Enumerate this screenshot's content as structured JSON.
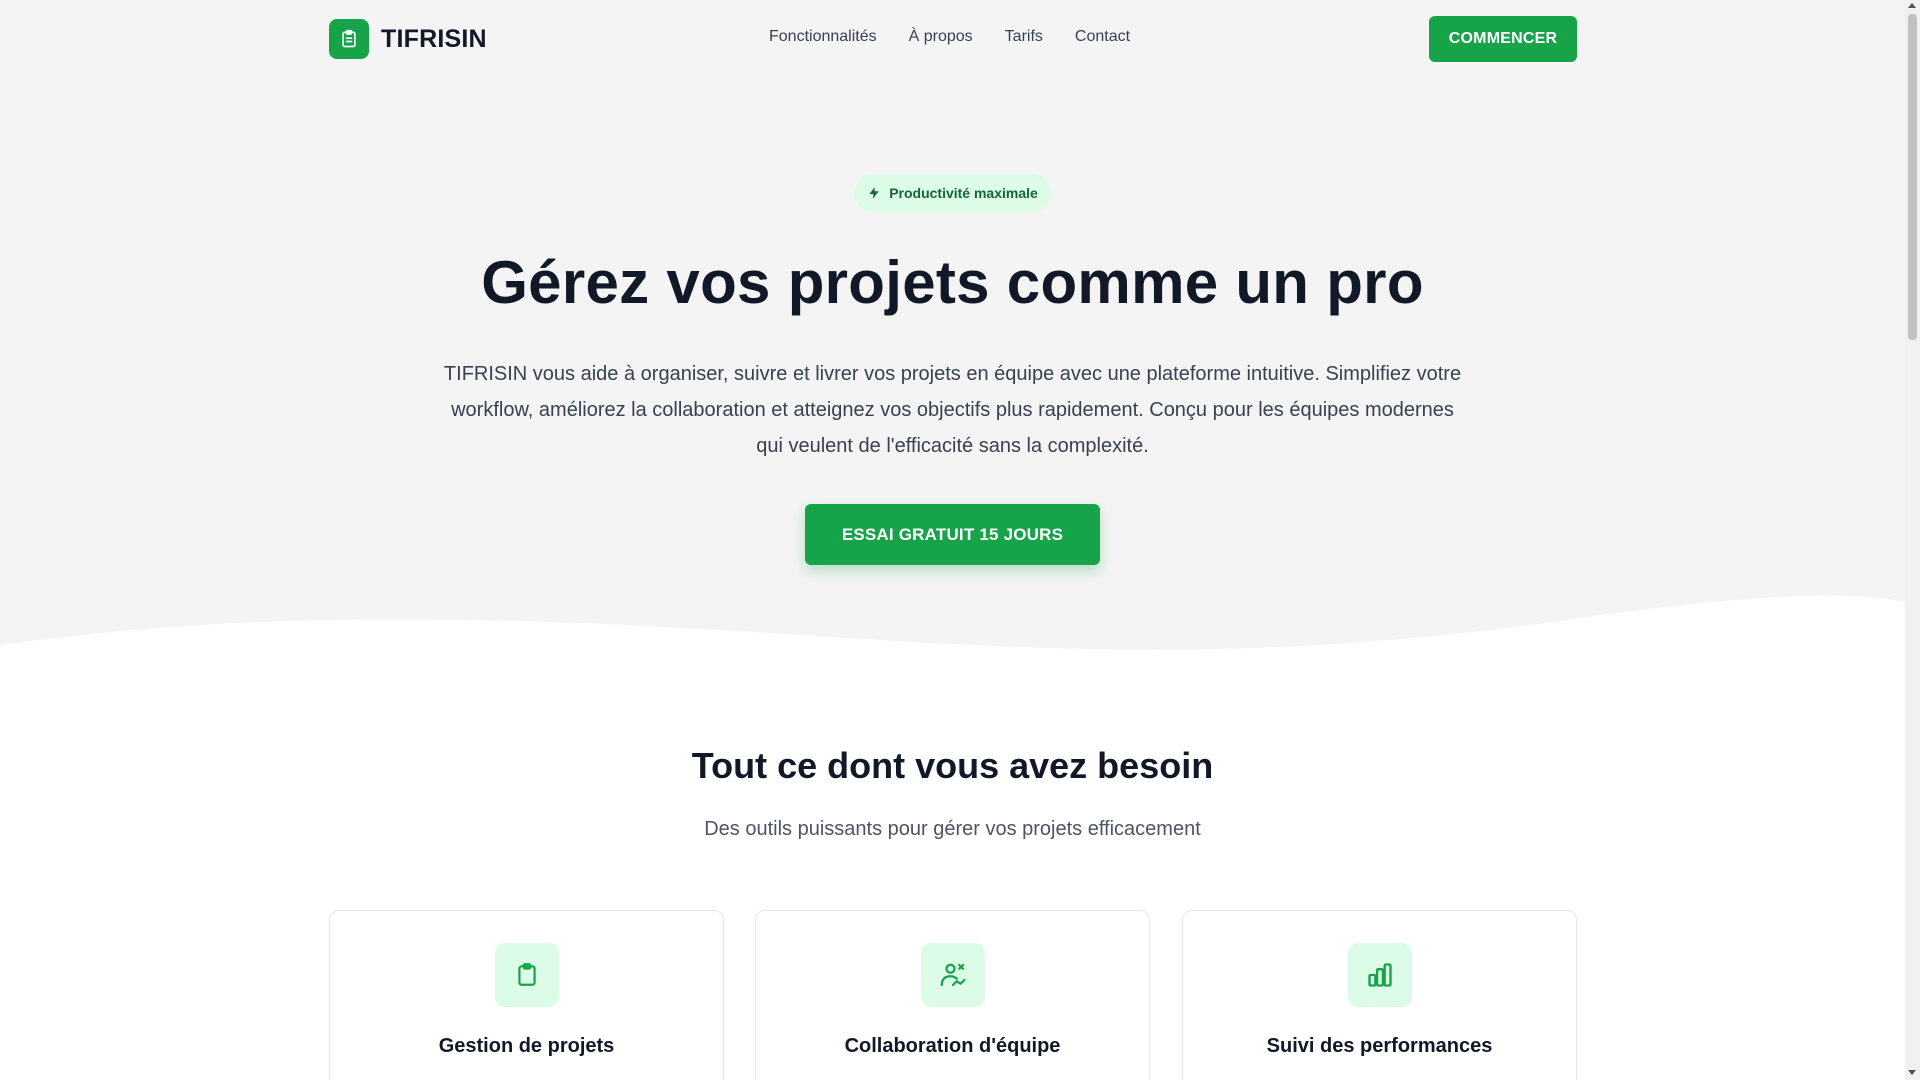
{
  "header": {
    "brand": "TIFRISIN",
    "logo_icon": "clipboard-icon",
    "nav": [
      "Fonctionnalités",
      "À propos",
      "Tarifs",
      "Contact"
    ],
    "cta_label": "COMMENCER"
  },
  "hero": {
    "badge_icon": "lightning-icon",
    "badge_text": "Productivité maximale",
    "title": "Gérez vos projets comme un pro",
    "description": "TIFRISIN vous aide à organiser, suivre et livrer vos projets en équipe avec une plateforme intuitive. Simplifiez votre workflow, améliorez la collaboration et atteignez vos objectifs plus rapidement. Conçu pour les équipes modernes qui veulent de l'efficacité sans la complexité.",
    "cta_label": "ESSAI GRATUIT 15 JOURS"
  },
  "features": {
    "title": "Tout ce dont vous avez besoin",
    "subtitle": "Des outils puissants pour gérer vos projets efficacement",
    "cards": [
      {
        "icon": "clipboard-icon",
        "title": "Gestion de projets"
      },
      {
        "icon": "team-handshake-icon",
        "title": "Collaboration d'équipe"
      },
      {
        "icon": "bar-chart-icon",
        "title": "Suivi des performances"
      }
    ]
  },
  "colors": {
    "accent": "#16a34a",
    "accent_light": "#dcfce7",
    "hero_bg": "#f4f4f4",
    "text_dark": "#111827"
  }
}
